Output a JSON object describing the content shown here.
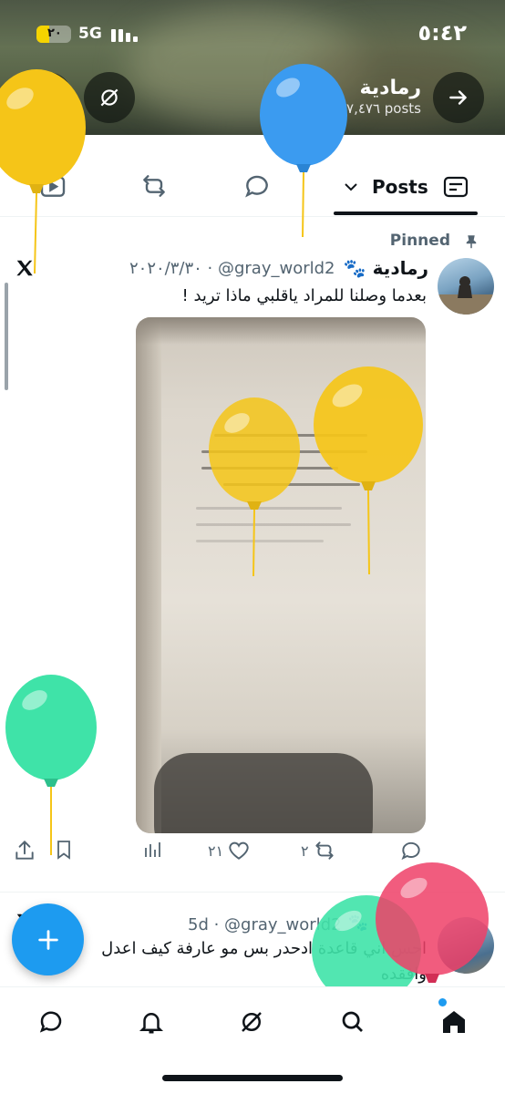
{
  "status_bar": {
    "time": "٥:٤٢",
    "network": "5G",
    "battery": "٢٠"
  },
  "profile": {
    "name": "رمادية",
    "posts_count": "٧,٤٧٦ posts"
  },
  "tabs": {
    "active_label": "Posts"
  },
  "pinned_label": "Pinned",
  "post": {
    "author_name": "رمادية 🐾",
    "meta": "٢٠٢٠/٣/٣٠ · @gray_world2",
    "text": "بعدما وصلنا للمراد ياقلبي ماذا تريد !",
    "likes": "٢١",
    "reposts": "٢"
  },
  "post2": {
    "author_name": "🐾",
    "meta": "5d · @gray_world2",
    "text_line1": "احس اني قاعدة ادحدر بس مو عارفة كيف اعدل",
    "text_line2": "وافقده"
  },
  "icons": {
    "back": "arrow-right-icon",
    "grok": "grok-icon",
    "search": "search-icon",
    "x_logo": "x-logo-icon",
    "pin": "pin-icon"
  },
  "colors": {
    "accent": "#1d9bf0",
    "text": "#0f1419",
    "muted": "#536471"
  }
}
